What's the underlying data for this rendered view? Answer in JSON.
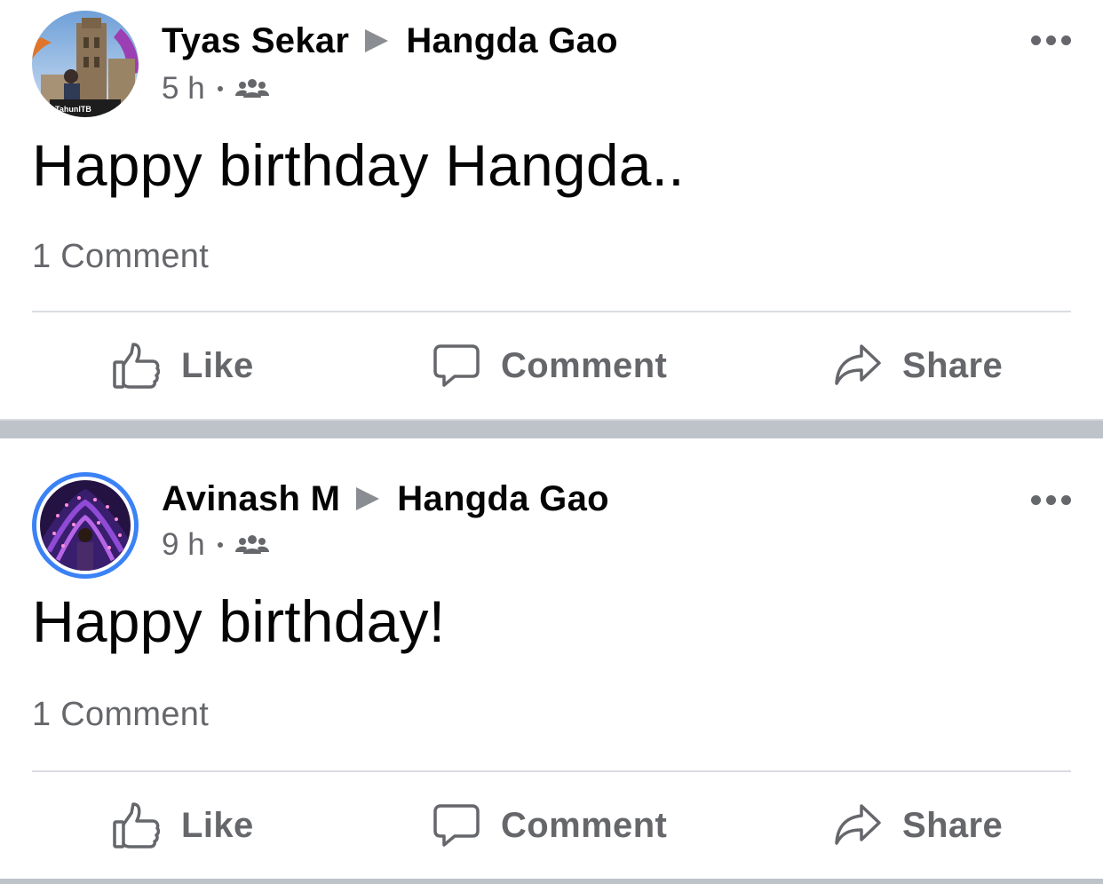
{
  "posts": [
    {
      "author": "Tyas Sekar",
      "target": "Hangda Gao",
      "time": "5 h",
      "audience_icon": "friends-icon",
      "avatar_badge": "TahunITB",
      "text": "Happy birthday Hangda..",
      "comment_count": "1 Comment",
      "actions": {
        "like": "Like",
        "comment": "Comment",
        "share": "Share"
      }
    },
    {
      "author": "Avinash M",
      "target": "Hangda Gao",
      "time": "9 h",
      "audience_icon": "friends-icon",
      "text": "Happy birthday!",
      "comment_count": "1 Comment",
      "actions": {
        "like": "Like",
        "comment": "Comment",
        "share": "Share"
      }
    }
  ],
  "colors": {
    "secondary_text": "#65676b",
    "divider": "#dadde1",
    "section_gap": "#bec3c9",
    "story_ring": "#3b82f6"
  }
}
